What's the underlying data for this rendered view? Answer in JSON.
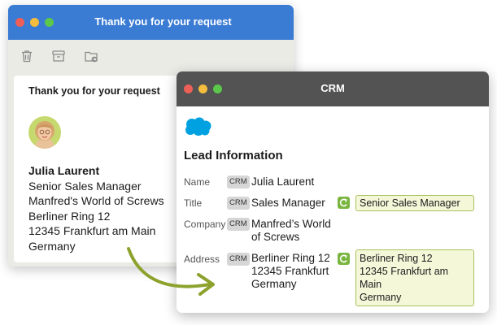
{
  "colors": {
    "mail_titlebar": "#3a7bd4",
    "crm_titlebar": "#535353",
    "suggestion_fill": "#f5f7d9",
    "suggestion_border": "#a6c35c",
    "sync_icon": "#7ab540",
    "arrow": "#8ca22c",
    "salesforce_blue": "#00a1e0"
  },
  "mail": {
    "window_title": "Thank you for your request",
    "toolbar_icons": [
      "trash-icon",
      "archive-icon",
      "move-to-folder-icon"
    ],
    "subject": "Thank you for your request",
    "signature": {
      "name": "Julia Laurent",
      "lines": [
        "Senior Sales Manager",
        "Manfred's World of Screws",
        "Berliner Ring 12",
        "12345 Frankfurt am Main",
        "Germany"
      ]
    }
  },
  "crm": {
    "window_title": "CRM",
    "logo_icon": "salesforce-cloud-icon",
    "heading": "Lead Information",
    "badge": "CRM",
    "fields": {
      "name": {
        "label": "Name",
        "lines": [
          "Julia Laurent"
        ]
      },
      "title": {
        "label": "Title",
        "lines": [
          "Sales Manager"
        ],
        "suggestion": [
          "Senior Sales Manager"
        ]
      },
      "company": {
        "label": "Company",
        "lines": [
          "Manfred’s World",
          "of Screws"
        ]
      },
      "address": {
        "label": "Address",
        "lines": [
          "Berliner Ring 12",
          "12345 Frankfurt",
          "Germany"
        ],
        "suggestion": [
          "Berliner Ring 12",
          "12345 Frankfurt am Main",
          "Germany"
        ]
      }
    }
  }
}
